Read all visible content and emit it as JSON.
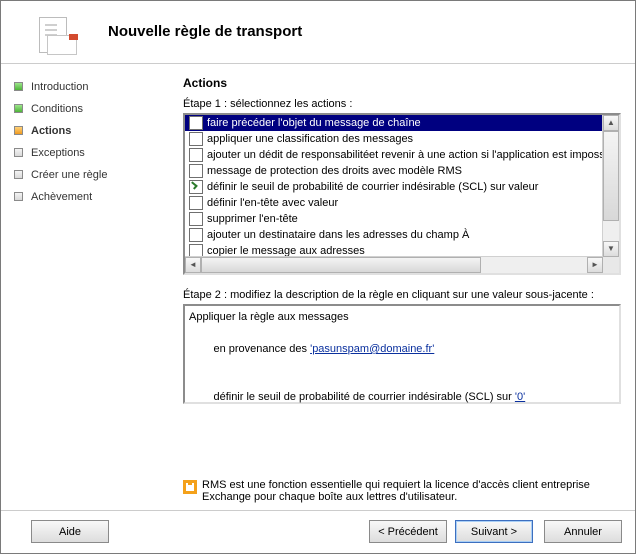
{
  "header": {
    "title": "Nouvelle règle de transport"
  },
  "sidebar": {
    "items": [
      {
        "label": "Introduction",
        "state": "done"
      },
      {
        "label": "Conditions",
        "state": "done"
      },
      {
        "label": "Actions",
        "state": "current"
      },
      {
        "label": "Exceptions",
        "state": "pending"
      },
      {
        "label": "Créer une règle",
        "state": "pending"
      },
      {
        "label": "Achèvement",
        "state": "pending"
      }
    ]
  },
  "main": {
    "section_title": "Actions",
    "step1_label": "Étape 1 : sélectionnez les actions :",
    "actions": [
      {
        "label": "faire précéder l'objet du message de chaîne",
        "checked": false,
        "selected": true
      },
      {
        "label": "appliquer une classification des messages",
        "checked": false,
        "selected": false
      },
      {
        "label": "ajouter un dédit de responsabilitéet revenir à une action si l'application est impossible",
        "checked": false,
        "selected": false
      },
      {
        "label": "message de protection des droits avec modèle RMS",
        "checked": false,
        "selected": false
      },
      {
        "label": "définir le seuil de probabilité de courrier indésirable (SCL) sur valeur",
        "checked": true,
        "selected": false
      },
      {
        "label": "définir l'en-tête avec valeur",
        "checked": false,
        "selected": false
      },
      {
        "label": "supprimer l'en-tête",
        "checked": false,
        "selected": false
      },
      {
        "label": "ajouter un destinataire dans les adresses du champ À",
        "checked": false,
        "selected": false
      },
      {
        "label": "copier le message aux adresses",
        "checked": false,
        "selected": false
      }
    ],
    "step2_label": "Étape 2 : modifiez la description de la règle en cliquant sur une valeur sous-jacente :",
    "description": {
      "line1_text": "Appliquer la règle aux messages",
      "line2_prefix": "en provenance des ",
      "line2_link": "'pasunspam@domaine.fr'",
      "line3_prefix": "définir le seuil de probabilité de courrier indésirable (SCL) sur ",
      "line3_link": "'0'"
    }
  },
  "info": {
    "text": "RMS est une fonction essentielle qui requiert la licence d'accès client entreprise Exchange pour chaque boîte aux lettres d'utilisateur."
  },
  "buttons": {
    "help": "Aide",
    "prev": "< Précédent",
    "next": "Suivant >",
    "cancel": "Annuler"
  }
}
